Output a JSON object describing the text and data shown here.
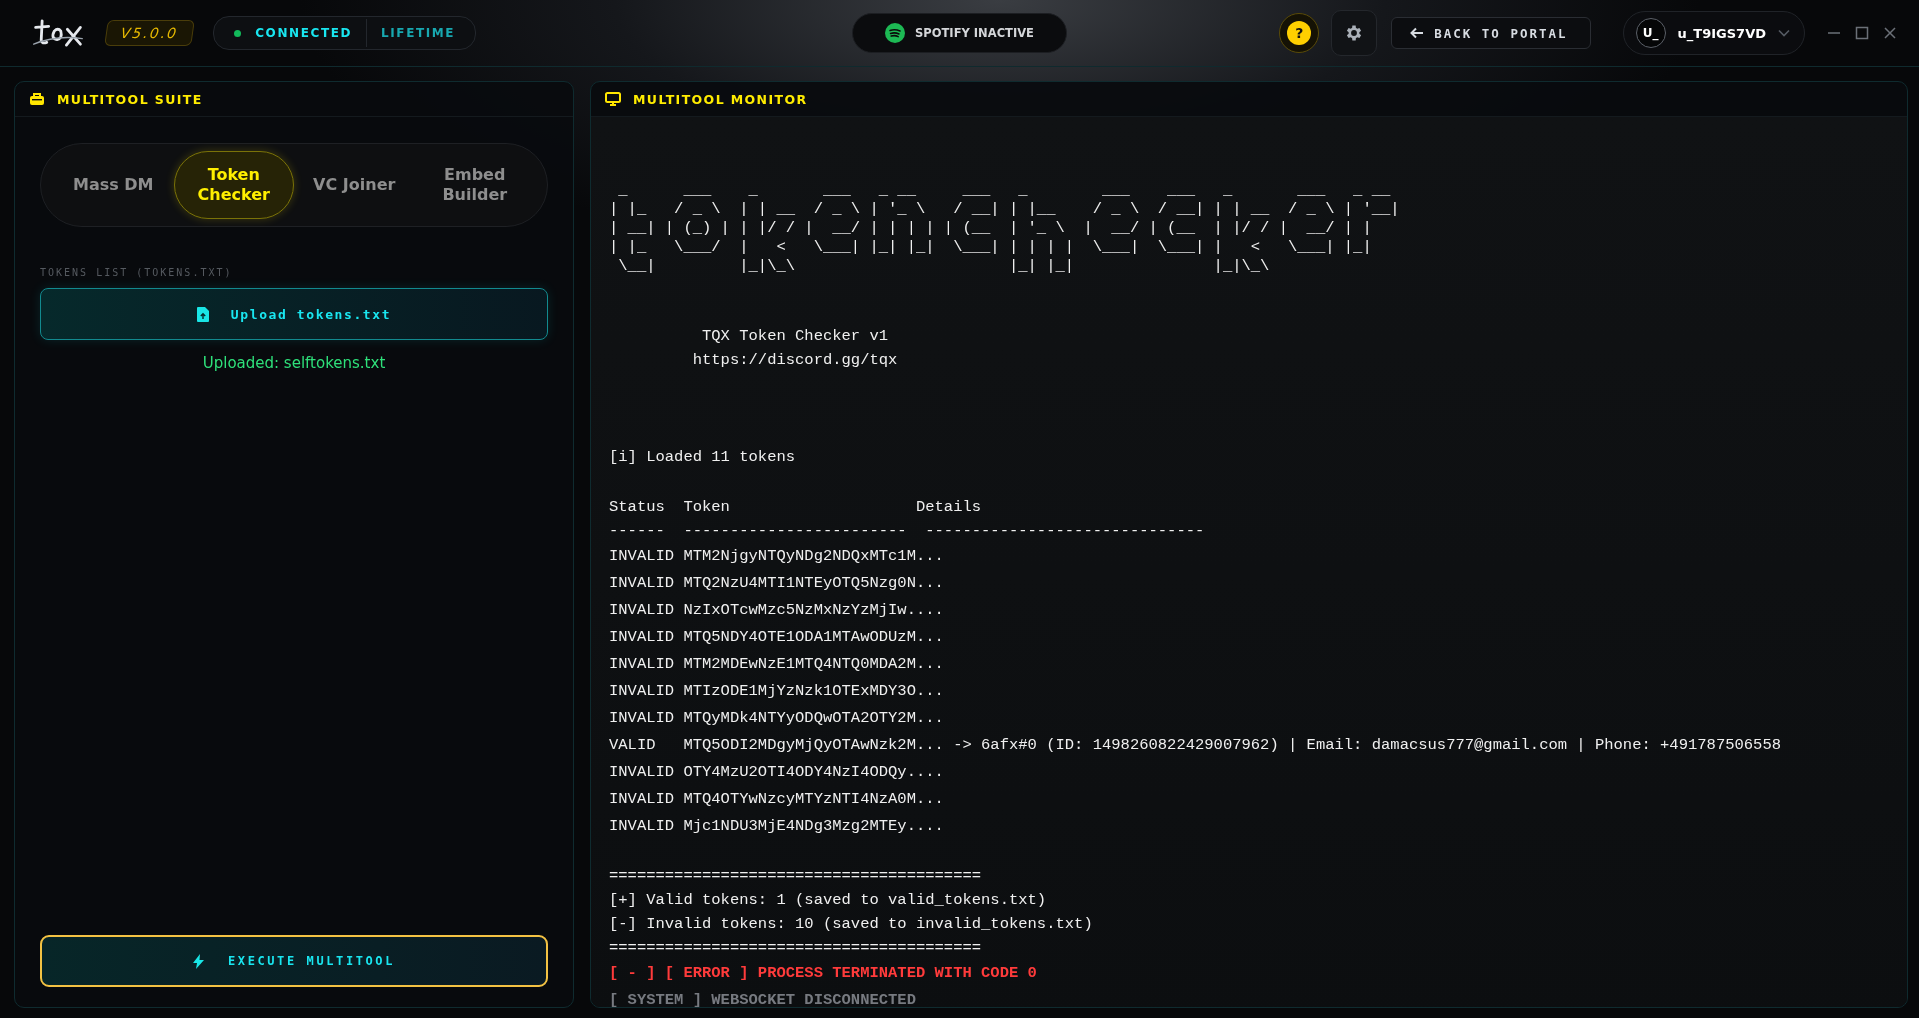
{
  "header": {
    "version": "V5.0.0",
    "status": {
      "label": "CONNECTED",
      "connected": true
    },
    "plan": "LIFETIME",
    "spotify": {
      "label": "SPOTIFY INACTIVE",
      "active": false
    },
    "help": "?",
    "back_button": "BACK TO PORTAL",
    "user": {
      "avatar": "U_",
      "name": "u_T9IGS7VD"
    }
  },
  "left_panel": {
    "title": "MULTITOOL SUITE",
    "tabs": [
      {
        "label": "Mass DM",
        "selected": false
      },
      {
        "label": "Token Checker",
        "selected": true
      },
      {
        "label": "VC Joiner",
        "selected": false
      },
      {
        "label": "Embed Builder",
        "selected": false
      }
    ],
    "tokens_label": "TOKENS LIST (TOKENS.TXT)",
    "upload_button": "Upload tokens.txt",
    "upload_status": "Uploaded: selftokens.txt",
    "execute_button": "EXECUTE MULTITOOL"
  },
  "monitor": {
    "title": "MULTITOOL MONITOR",
    "lines": [
      {
        "kind": "blank"
      },
      {
        "kind": "blank"
      },
      {
        "kind": "art",
        "text": " _      ___    _       ___   _ __     ___   _        ___    ___   _       ___   _ __"
      },
      {
        "kind": "art",
        "text": "| |_   / _ \\  | | __  / _ \\ | '_ \\   / __| | |__    / _ \\  / __| | | __  / _ \\ | '__|"
      },
      {
        "kind": "art",
        "text": "| __| | (_) | | |/ / |  __/ | | | | | (__  | '_ \\  |  __/ | (__  | |/ / |  __/ | |"
      },
      {
        "kind": "art",
        "text": "| |_   \\___/  |   <   \\___| |_| |_|  \\___| | | | |  \\___|  \\___| |   <   \\___| |_|"
      },
      {
        "kind": "art",
        "text": " \\__|         |_|\\_\\                       |_| |_|               |_|\\_\\"
      },
      {
        "kind": "blank"
      },
      {
        "kind": "blank"
      },
      {
        "kind": "text",
        "text": "          TQX Token Checker v1"
      },
      {
        "kind": "text",
        "text": "         https://discord.gg/tqx"
      },
      {
        "kind": "blank"
      },
      {
        "kind": "blank"
      },
      {
        "kind": "blank"
      },
      {
        "kind": "row",
        "text": "[i] Loaded 11 tokens"
      },
      {
        "kind": "blank"
      },
      {
        "kind": "text",
        "text": "Status  Token                    Details"
      },
      {
        "kind": "text",
        "text": "------  ------------------------  ------------------------------"
      },
      {
        "kind": "row",
        "text": "INVALID MTM2NjgyNTQyNDg2NDQxMTc1M..."
      },
      {
        "kind": "row",
        "text": "INVALID MTQ2NzU4MTI1NTEyOTQ5Nzg0N..."
      },
      {
        "kind": "row",
        "text": "INVALID NzIxOTcwMzc5NzMxNzYzMjIw...."
      },
      {
        "kind": "row",
        "text": "INVALID MTQ5NDY4OTE1ODA1MTAwODUzM..."
      },
      {
        "kind": "row",
        "text": "INVALID MTM2MDEwNzE1MTQ4NTQ0MDA2M..."
      },
      {
        "kind": "row",
        "text": "INVALID MTIzODE1MjYzNzk1OTExMDY3O..."
      },
      {
        "kind": "row",
        "text": "INVALID MTQyMDk4NTYyODQwOTA2OTY2M..."
      },
      {
        "kind": "row",
        "text": "VALID   MTQ5ODI2MDgyMjQyOTAwNzk2M... -> 6afx#0 (ID: 1498260822429007962) | Email: damacsus777@gmail.com | Phone: +491787506558"
      },
      {
        "kind": "row",
        "text": "INVALID OTY4MzU2OTI4ODY4NzI4ODQy...."
      },
      {
        "kind": "row",
        "text": "INVALID MTQ4OTYwNzcyMTYzNTI4NzA0M..."
      },
      {
        "kind": "row",
        "text": "INVALID Mjc1NDU3MjE4NDg3Mzg2MTEy...."
      },
      {
        "kind": "blank"
      },
      {
        "kind": "text",
        "text": "========================================"
      },
      {
        "kind": "text",
        "text": "[+] Valid tokens: 1 (saved to valid_tokens.txt)"
      },
      {
        "kind": "text",
        "text": "[-] Invalid tokens: 10 (saved to invalid_tokens.txt)"
      },
      {
        "kind": "text",
        "text": "========================================"
      },
      {
        "kind": "error",
        "text": "[ - ] [ ERROR ] PROCESS TERMINATED WITH CODE 0"
      },
      {
        "kind": "system",
        "text": "[ SYSTEM ] WEBSOCKET DISCONNECTED"
      }
    ]
  }
}
